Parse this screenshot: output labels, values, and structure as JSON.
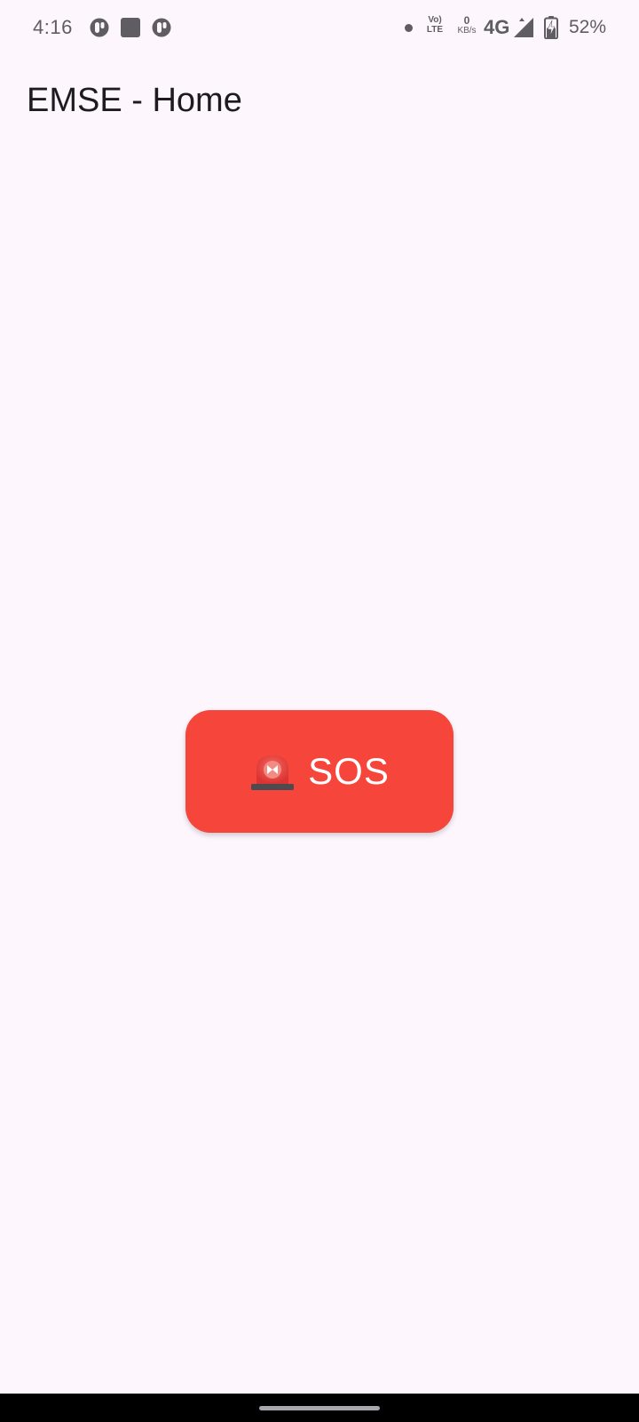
{
  "status_bar": {
    "time": "4:16",
    "notification_icons": [
      "app-notification-icon",
      "square-app-icon",
      "app-notification-icon"
    ],
    "volte_label": "Vo) LTE",
    "volte_top": "Vo)",
    "volte_bottom": "LTE",
    "speed_value": "0",
    "speed_unit": "KB/s",
    "network_type": "4G",
    "battery_percent": "52%",
    "battery_level": 0.52
  },
  "app_bar": {
    "title": "EMSE - Home"
  },
  "main": {
    "sos_button": {
      "label": "SOS",
      "icon": "siren-icon",
      "color": "#f6453b"
    }
  },
  "colors": {
    "background": "#fdf7fd",
    "accent": "#f6453b",
    "status_text": "#5f5c63",
    "title_text": "#1d1b20"
  }
}
